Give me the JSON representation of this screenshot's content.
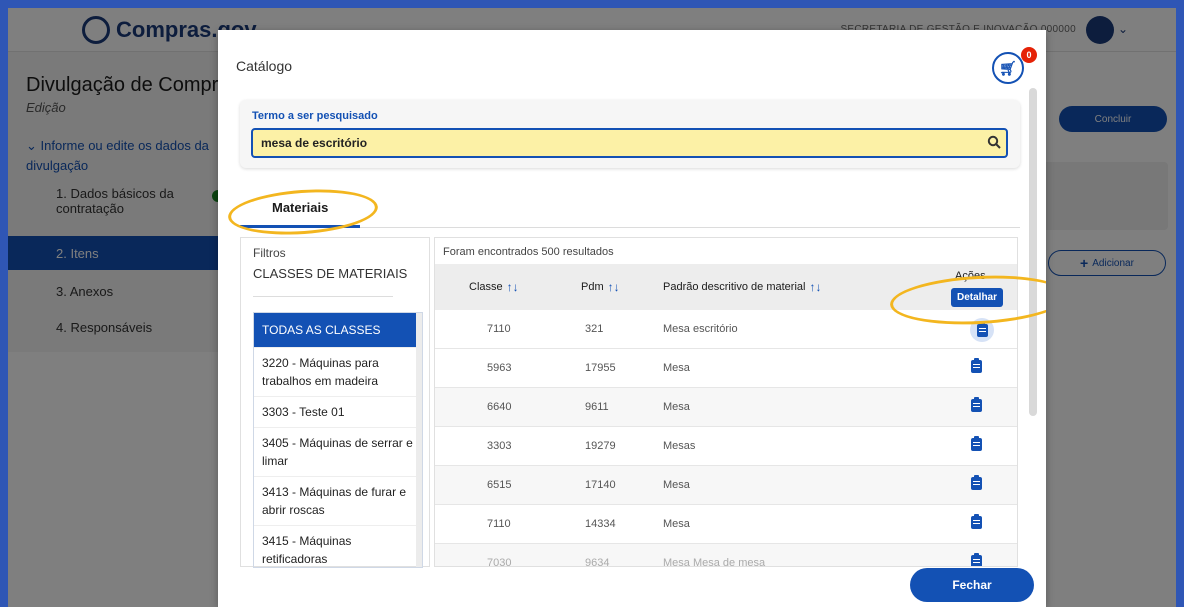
{
  "app": {
    "logo_text": "Compras.gov",
    "header_user_text": "SECRETARIA DE GESTÃO E INOVAÇÃO 000000",
    "page_title": "Divulgação de Compras",
    "page_subtitle": "Edição",
    "section_label": "Informe ou edite os dados da divulgação",
    "steps": [
      {
        "label": "1. Dados básicos da contratação"
      },
      {
        "label": "2. Itens"
      },
      {
        "label": "3. Anexos"
      },
      {
        "label": "4. Responsáveis"
      }
    ],
    "concluir_label": "Concluir",
    "adicionar_label": "Adicionar"
  },
  "modal": {
    "title": "Catálogo",
    "cart_count": "0",
    "search": {
      "label": "Termo a ser pesquisado",
      "value": "mesa de escritório"
    },
    "tab_label": "Materiais",
    "filters": {
      "title": "Filtros",
      "subtitle": "CLASSES DE MATERIAIS",
      "classes": [
        "TODAS AS CLASSES",
        "3220 - Máquinas para trabalhos em madeira",
        "3303 - Teste 01",
        "3405 - Máquinas de serrar e limar",
        "3413 - Máquinas de furar e abrir roscas",
        "3415 - Máquinas retificadoras"
      ]
    },
    "results": {
      "count_text": "Foram encontrados 500 resultados",
      "headers": {
        "classe": "Classe",
        "pdm": "Pdm",
        "descricao": "Padrão descritivo de material",
        "acoes": "Ações"
      },
      "rows": [
        {
          "classe": "7110",
          "pdm": "321",
          "descricao": "Mesa escritório"
        },
        {
          "classe": "5963",
          "pdm": "17955",
          "descricao": "Mesa"
        },
        {
          "classe": "6640",
          "pdm": "9611",
          "descricao": "Mesa"
        },
        {
          "classe": "3303",
          "pdm": "19279",
          "descricao": "Mesas"
        },
        {
          "classe": "6515",
          "pdm": "17140",
          "descricao": "Mesa"
        },
        {
          "classe": "7110",
          "pdm": "14334",
          "descricao": "Mesa"
        },
        {
          "classe": "7030",
          "pdm": "9634",
          "descricao": "Mesa Mesa de mesa"
        }
      ],
      "tooltip": "Detalhar"
    },
    "close_label": "Fechar"
  },
  "colors": {
    "primary": "#1351b4",
    "highlight": "#f3b61f",
    "search_bg": "#fcf1a6",
    "badge": "#e52207"
  }
}
